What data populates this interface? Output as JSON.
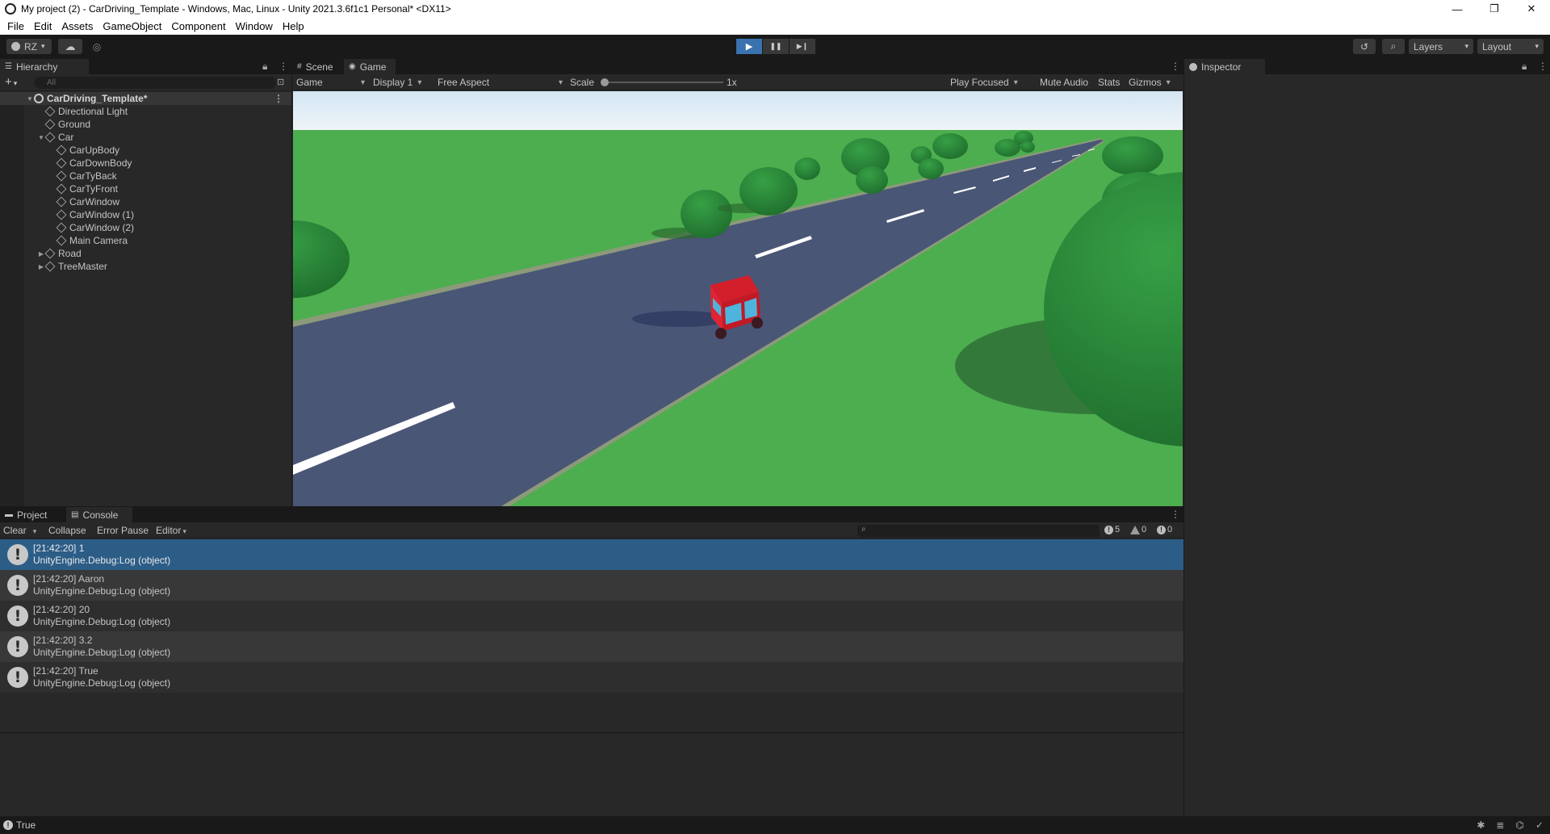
{
  "window": {
    "title": "My project (2) - CarDriving_Template - Windows, Mac, Linux - Unity 2021.3.6f1c1 Personal* <DX11>",
    "minimize": "—",
    "maximize": "❐",
    "close": "✕"
  },
  "menu": [
    "File",
    "Edit",
    "Assets",
    "GameObject",
    "Component",
    "Window",
    "Help"
  ],
  "toolbar": {
    "account": "RZ",
    "layers": "Layers",
    "layout": "Layout",
    "play": "▶",
    "pause": "❚❚",
    "step": "▶❙"
  },
  "hierarchy": {
    "tab": "Hierarchy",
    "search_placeholder": "All",
    "scene": "CarDriving_Template*",
    "items": [
      {
        "label": "Directional Light",
        "depth": 1,
        "arrow": ""
      },
      {
        "label": "Ground",
        "depth": 1,
        "arrow": ""
      },
      {
        "label": "Car",
        "depth": 1,
        "arrow": "▼"
      },
      {
        "label": "CarUpBody",
        "depth": 2,
        "arrow": ""
      },
      {
        "label": "CarDownBody",
        "depth": 2,
        "arrow": ""
      },
      {
        "label": "CarTyBack",
        "depth": 2,
        "arrow": ""
      },
      {
        "label": "CarTyFront",
        "depth": 2,
        "arrow": ""
      },
      {
        "label": "CarWindow",
        "depth": 2,
        "arrow": ""
      },
      {
        "label": "CarWindow (1)",
        "depth": 2,
        "arrow": ""
      },
      {
        "label": "CarWindow (2)",
        "depth": 2,
        "arrow": ""
      },
      {
        "label": "Main Camera",
        "depth": 2,
        "arrow": ""
      },
      {
        "label": "Road",
        "depth": 1,
        "arrow": "▶"
      },
      {
        "label": "TreeMaster",
        "depth": 1,
        "arrow": "▶"
      }
    ]
  },
  "game": {
    "tab_scene": "Scene",
    "tab_game": "Game",
    "mode": "Game",
    "display": "Display 1",
    "aspect": "Free Aspect",
    "scale_label": "Scale",
    "scale_value": "1x",
    "play_focused": "Play Focused",
    "mute": "Mute Audio",
    "stats": "Stats",
    "gizmos": "Gizmos"
  },
  "inspector": {
    "tab": "Inspector"
  },
  "console": {
    "tab_project": "Project",
    "tab_console": "Console",
    "clear": "Clear",
    "collapse": "Collapse",
    "error_pause": "Error Pause",
    "editor": "Editor",
    "count_log": "5",
    "count_warn": "0",
    "count_error": "0",
    "entries": [
      {
        "line1": "[21:42:20] 1",
        "line2": "UnityEngine.Debug:Log (object)"
      },
      {
        "line1": "[21:42:20] Aaron",
        "line2": "UnityEngine.Debug:Log (object)"
      },
      {
        "line1": "[21:42:20] 20",
        "line2": "UnityEngine.Debug:Log (object)"
      },
      {
        "line1": "[21:42:20] 3.2",
        "line2": "UnityEngine.Debug:Log (object)"
      },
      {
        "line1": "[21:42:20] True",
        "line2": "UnityEngine.Debug:Log (object)"
      }
    ]
  },
  "status": {
    "text": "True"
  },
  "colors": {
    "sky_top": "#dcebf5",
    "grass": "#4caf50",
    "road": "#4a5676",
    "tree": "#2e8b3c",
    "car": "#e0202e",
    "accent": "#3a72b0",
    "selected_row": "#2c5d87"
  }
}
